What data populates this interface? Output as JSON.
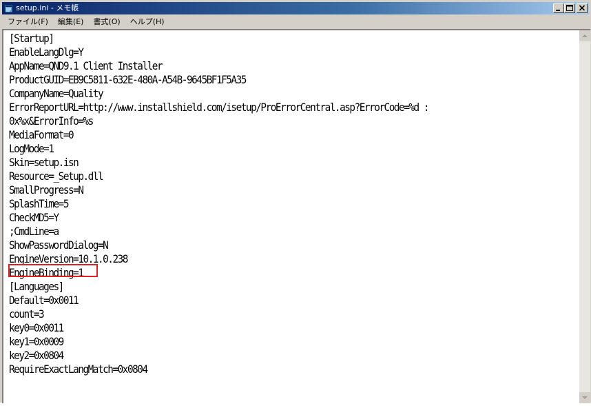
{
  "window": {
    "title": "setup.ini - メモ帳",
    "controls": {
      "minimize": "_",
      "maximize": "□",
      "close": "×"
    }
  },
  "menu": {
    "items": [
      "ファイル(F)",
      "編集(E)",
      "書式(O)",
      "ヘルプ(H)"
    ]
  },
  "editor": {
    "lines": [
      "[Startup]",
      "EnableLangDlg=Y",
      "AppName=QND9.1 Client Installer",
      "ProductGUID=EB9C5811-632E-480A-A54B-9645BF1F5A35",
      "CompanyName=Quality",
      "ErrorReportURL=http://www.installshield.com/isetup/ProErrorCentral.asp?ErrorCode=%d :",
      "0x%x&ErrorInfo=%s",
      "MediaFormat=0",
      "LogMode=1",
      "Skin=setup.isn",
      "Resource=_Setup.dll",
      "SmallProgress=N",
      "SplashTime=5",
      "CheckMD5=Y",
      ";CmdLine=a",
      "ShowPasswordDialog=N",
      "EngineVersion=10.1.0.238",
      "EngineBinding=1",
      "[Languages]",
      "Default=0x0011",
      "count=3",
      "key0=0x0011",
      "key1=0x0009",
      "key2=0x0804",
      "RequireExactLangMatch=0x0804"
    ],
    "highlighted_line": ";CmdLine=a",
    "highlight_color": "#e02020"
  }
}
